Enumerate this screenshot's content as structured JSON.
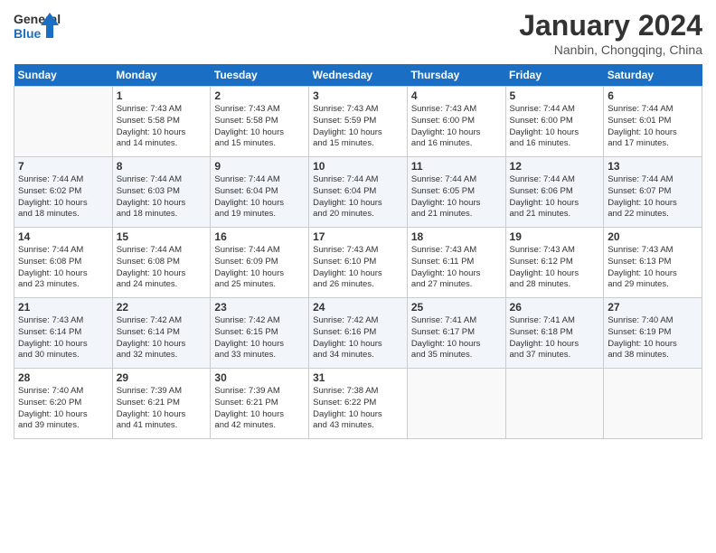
{
  "logo": {
    "line1": "General",
    "line2": "Blue"
  },
  "title": "January 2024",
  "location": "Nanbin, Chongqing, China",
  "days_of_week": [
    "Sunday",
    "Monday",
    "Tuesday",
    "Wednesday",
    "Thursday",
    "Friday",
    "Saturday"
  ],
  "weeks": [
    [
      {
        "day": "",
        "info": ""
      },
      {
        "day": "1",
        "info": "Sunrise: 7:43 AM\nSunset: 5:58 PM\nDaylight: 10 hours\nand 14 minutes."
      },
      {
        "day": "2",
        "info": "Sunrise: 7:43 AM\nSunset: 5:58 PM\nDaylight: 10 hours\nand 15 minutes."
      },
      {
        "day": "3",
        "info": "Sunrise: 7:43 AM\nSunset: 5:59 PM\nDaylight: 10 hours\nand 15 minutes."
      },
      {
        "day": "4",
        "info": "Sunrise: 7:43 AM\nSunset: 6:00 PM\nDaylight: 10 hours\nand 16 minutes."
      },
      {
        "day": "5",
        "info": "Sunrise: 7:44 AM\nSunset: 6:00 PM\nDaylight: 10 hours\nand 16 minutes."
      },
      {
        "day": "6",
        "info": "Sunrise: 7:44 AM\nSunset: 6:01 PM\nDaylight: 10 hours\nand 17 minutes."
      }
    ],
    [
      {
        "day": "7",
        "info": "Sunrise: 7:44 AM\nSunset: 6:02 PM\nDaylight: 10 hours\nand 18 minutes."
      },
      {
        "day": "8",
        "info": "Sunrise: 7:44 AM\nSunset: 6:03 PM\nDaylight: 10 hours\nand 18 minutes."
      },
      {
        "day": "9",
        "info": "Sunrise: 7:44 AM\nSunset: 6:04 PM\nDaylight: 10 hours\nand 19 minutes."
      },
      {
        "day": "10",
        "info": "Sunrise: 7:44 AM\nSunset: 6:04 PM\nDaylight: 10 hours\nand 20 minutes."
      },
      {
        "day": "11",
        "info": "Sunrise: 7:44 AM\nSunset: 6:05 PM\nDaylight: 10 hours\nand 21 minutes."
      },
      {
        "day": "12",
        "info": "Sunrise: 7:44 AM\nSunset: 6:06 PM\nDaylight: 10 hours\nand 21 minutes."
      },
      {
        "day": "13",
        "info": "Sunrise: 7:44 AM\nSunset: 6:07 PM\nDaylight: 10 hours\nand 22 minutes."
      }
    ],
    [
      {
        "day": "14",
        "info": "Sunrise: 7:44 AM\nSunset: 6:08 PM\nDaylight: 10 hours\nand 23 minutes."
      },
      {
        "day": "15",
        "info": "Sunrise: 7:44 AM\nSunset: 6:08 PM\nDaylight: 10 hours\nand 24 minutes."
      },
      {
        "day": "16",
        "info": "Sunrise: 7:44 AM\nSunset: 6:09 PM\nDaylight: 10 hours\nand 25 minutes."
      },
      {
        "day": "17",
        "info": "Sunrise: 7:43 AM\nSunset: 6:10 PM\nDaylight: 10 hours\nand 26 minutes."
      },
      {
        "day": "18",
        "info": "Sunrise: 7:43 AM\nSunset: 6:11 PM\nDaylight: 10 hours\nand 27 minutes."
      },
      {
        "day": "19",
        "info": "Sunrise: 7:43 AM\nSunset: 6:12 PM\nDaylight: 10 hours\nand 28 minutes."
      },
      {
        "day": "20",
        "info": "Sunrise: 7:43 AM\nSunset: 6:13 PM\nDaylight: 10 hours\nand 29 minutes."
      }
    ],
    [
      {
        "day": "21",
        "info": "Sunrise: 7:43 AM\nSunset: 6:14 PM\nDaylight: 10 hours\nand 30 minutes."
      },
      {
        "day": "22",
        "info": "Sunrise: 7:42 AM\nSunset: 6:14 PM\nDaylight: 10 hours\nand 32 minutes."
      },
      {
        "day": "23",
        "info": "Sunrise: 7:42 AM\nSunset: 6:15 PM\nDaylight: 10 hours\nand 33 minutes."
      },
      {
        "day": "24",
        "info": "Sunrise: 7:42 AM\nSunset: 6:16 PM\nDaylight: 10 hours\nand 34 minutes."
      },
      {
        "day": "25",
        "info": "Sunrise: 7:41 AM\nSunset: 6:17 PM\nDaylight: 10 hours\nand 35 minutes."
      },
      {
        "day": "26",
        "info": "Sunrise: 7:41 AM\nSunset: 6:18 PM\nDaylight: 10 hours\nand 37 minutes."
      },
      {
        "day": "27",
        "info": "Sunrise: 7:40 AM\nSunset: 6:19 PM\nDaylight: 10 hours\nand 38 minutes."
      }
    ],
    [
      {
        "day": "28",
        "info": "Sunrise: 7:40 AM\nSunset: 6:20 PM\nDaylight: 10 hours\nand 39 minutes."
      },
      {
        "day": "29",
        "info": "Sunrise: 7:39 AM\nSunset: 6:21 PM\nDaylight: 10 hours\nand 41 minutes."
      },
      {
        "day": "30",
        "info": "Sunrise: 7:39 AM\nSunset: 6:21 PM\nDaylight: 10 hours\nand 42 minutes."
      },
      {
        "day": "31",
        "info": "Sunrise: 7:38 AM\nSunset: 6:22 PM\nDaylight: 10 hours\nand 43 minutes."
      },
      {
        "day": "",
        "info": ""
      },
      {
        "day": "",
        "info": ""
      },
      {
        "day": "",
        "info": ""
      }
    ]
  ]
}
